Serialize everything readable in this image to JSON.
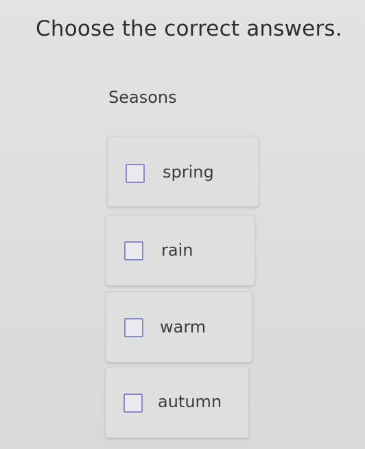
{
  "instruction": "Choose the correct answers.",
  "category": "Seasons",
  "options": [
    {
      "label": "spring",
      "checked": false
    },
    {
      "label": "rain",
      "checked": false
    },
    {
      "label": "warm",
      "checked": false
    },
    {
      "label": "autumn",
      "checked": false
    }
  ],
  "colors": {
    "background": "#dcdedd",
    "checkbox_border": "#8a89c9",
    "text": "#2f3234"
  }
}
